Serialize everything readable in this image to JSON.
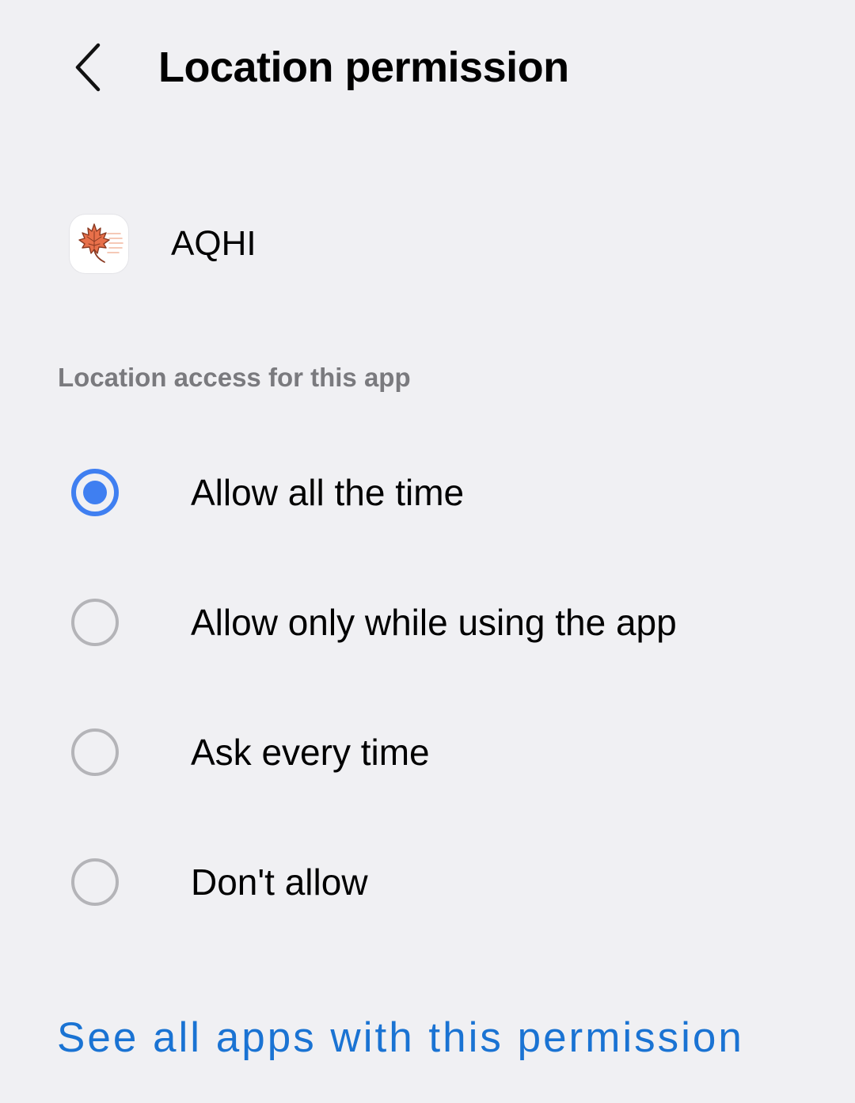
{
  "header": {
    "back_icon": "chevron-left-icon",
    "title": "Location permission"
  },
  "app": {
    "icon": "maple-leaf-icon",
    "name": "AQHI"
  },
  "section": {
    "label": "Location access for this app"
  },
  "options": [
    {
      "label": "Allow all the time",
      "selected": true
    },
    {
      "label": "Allow only while using the app",
      "selected": false
    },
    {
      "label": "Ask every time",
      "selected": false
    },
    {
      "label": "Don't allow",
      "selected": false
    }
  ],
  "footer": {
    "link_label": "See all apps with this permission"
  },
  "colors": {
    "background": "#f0f0f3",
    "accent_radio": "#3f7ff1",
    "link": "#1a73d3",
    "section_label": "#7a7a7e",
    "app_icon_leaf": "#e8704a"
  }
}
